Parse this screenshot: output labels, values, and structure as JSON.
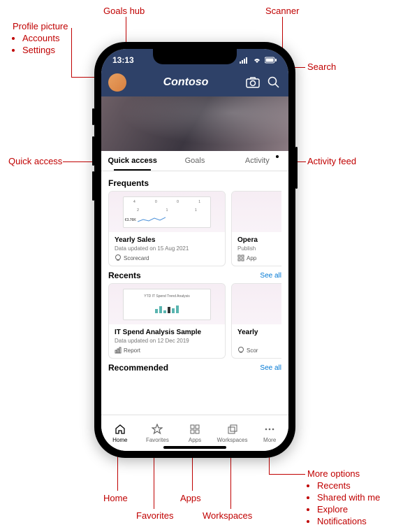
{
  "annotations": {
    "goals_hub": "Goals hub",
    "scanner": "Scanner",
    "profile": "Profile picture",
    "profile_sub1": "Accounts",
    "profile_sub2": "Settings",
    "search": "Search",
    "quick_access": "Quick access",
    "activity_feed": "Activity feed",
    "home": "Home",
    "favorites": "Favorites",
    "apps": "Apps",
    "workspaces": "Workspaces",
    "more": "More options",
    "more_sub1": "Recents",
    "more_sub2": "Shared with me",
    "more_sub3": "Explore",
    "more_sub4": "Notifications"
  },
  "status": {
    "time": "13:13"
  },
  "header": {
    "title": "Contoso"
  },
  "tabs": {
    "quick_access": "Quick access",
    "goals": "Goals",
    "activity": "Activity"
  },
  "sections": {
    "frequents": {
      "title": "Frequents",
      "card1": {
        "title": "Yearly Sales",
        "sub": "Data updated on 15 Aug 2021",
        "meta": "Scorecard"
      },
      "card2": {
        "title": "Opera",
        "sub": "Publish",
        "meta": "App"
      }
    },
    "recents": {
      "title": "Recents",
      "see_all": "See all",
      "thumb_label": "YTD IT Spend Trend Analysis",
      "card1": {
        "title": "IT Spend Analysis Sample",
        "sub": "Data updated on 12 Dec 2019",
        "meta": "Report"
      },
      "card2": {
        "title": "Yearly",
        "meta": "Scor"
      }
    },
    "recommended": {
      "title": "Recommended",
      "see_all": "See all"
    }
  },
  "nav": {
    "home": "Home",
    "favorites": "Favorites",
    "apps": "Apps",
    "workspaces": "Workspaces",
    "more": "More"
  }
}
